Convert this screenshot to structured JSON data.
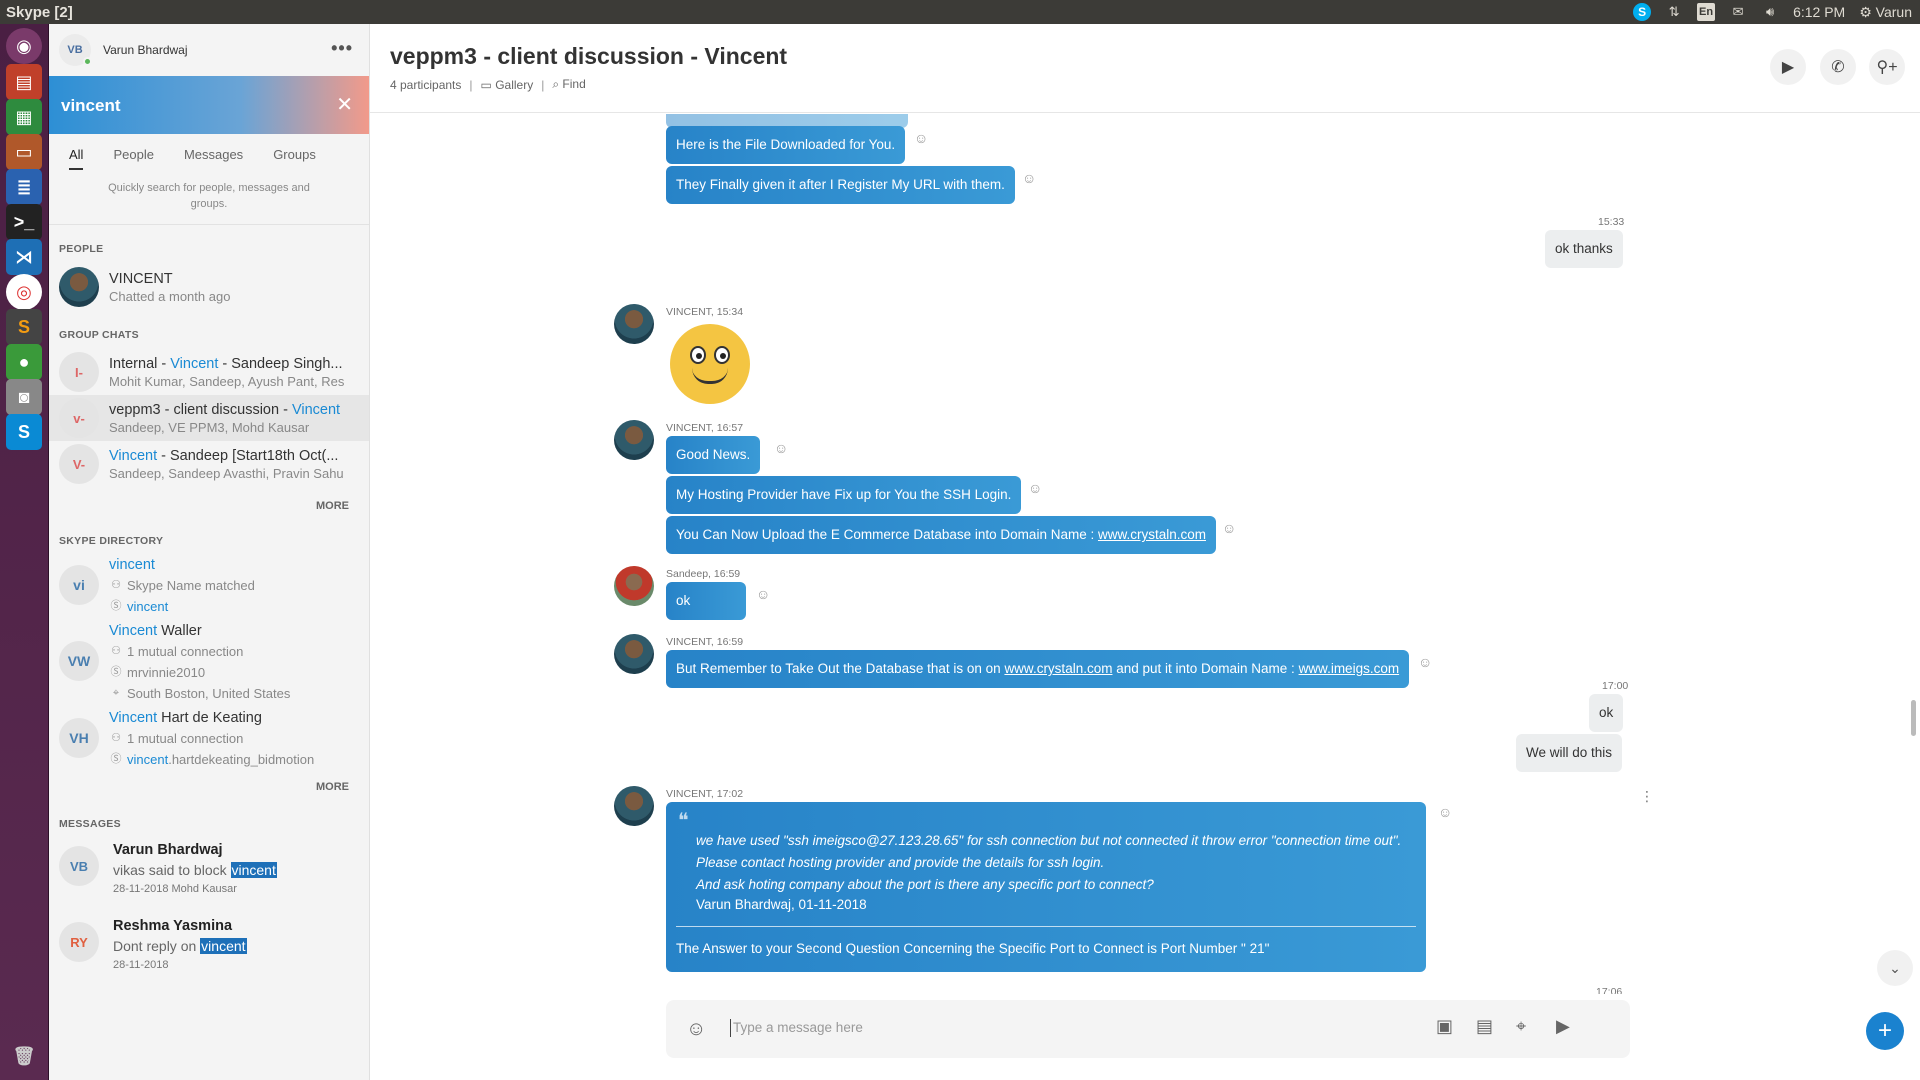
{
  "system": {
    "window_title": "Skype [2]",
    "lang": "En",
    "time": "6:12 PM",
    "user": "Varun"
  },
  "profile": {
    "initials": "VB",
    "name": "Varun Bhardwaj"
  },
  "search": {
    "value": "vincent"
  },
  "filters": [
    "All",
    "People",
    "Messages",
    "Groups"
  ],
  "filter_hint": "Quickly search for people, messages and groups.",
  "sections": {
    "people": "PEOPLE",
    "group_chats": "GROUP CHATS",
    "directory": "SKYPE DIRECTORY",
    "messages": "MESSAGES",
    "more": "MORE"
  },
  "people": [
    {
      "name": "VINCENT",
      "sub": "Chatted a month ago"
    }
  ],
  "group_chats": [
    {
      "initials": "I-",
      "pre": "Internal - ",
      "hl": "Vincent",
      "post": " - Sandeep Singh...",
      "sub": "Mohit Kumar, Sandeep, Ayush Pant, Res"
    },
    {
      "initials": "v-",
      "pre": "veppm3 - client discussion - ",
      "hl": "Vincent",
      "post": "",
      "sub": "Sandeep, VE PPM3, Mohd Kausar"
    },
    {
      "initials": "V-",
      "pre": "",
      "hl": "Vincent",
      "post": " - Sandeep [Start18th Oct(...",
      "sub": "Sandeep, Sandeep Avasthi, Pravin Sahu"
    }
  ],
  "directory": [
    {
      "initials": "vi",
      "hl": "vincent",
      "rest": "",
      "lines": [
        {
          "icon": "people-icon",
          "text": "Skype Name matched",
          "hl": false
        },
        {
          "icon": "skype-icon",
          "text": "vincent",
          "hl": true
        }
      ]
    },
    {
      "initials": "VW",
      "hl": "Vincent",
      "rest": " Waller",
      "lines": [
        {
          "icon": "people-icon",
          "text": "1 mutual connection",
          "hl": false
        },
        {
          "icon": "skype-icon",
          "text": "mrvinnie2010",
          "hl": false
        },
        {
          "icon": "location-icon",
          "text": "South Boston, United States",
          "hl": false
        }
      ]
    },
    {
      "initials": "VH",
      "hl": "Vincent",
      "rest": " Hart de Keating",
      "lines": [
        {
          "icon": "people-icon",
          "text": "1 mutual connection",
          "hl": false
        },
        {
          "icon": "skype-icon",
          "hlpart": "vincent",
          "text": ".hartdekeating_bidmotion",
          "hl": false
        }
      ]
    }
  ],
  "message_results": [
    {
      "initials": "VB",
      "name": "Varun Bhardwaj",
      "pre": "vikas said to block ",
      "hl": "vincent",
      "sub": "28-11-2018 Mohd Kausar"
    },
    {
      "initials": "RY",
      "name": "Reshma Yasmina",
      "pre": "Dont reply on ",
      "hl": "vincent",
      "sub": "28-11-2018"
    }
  ],
  "chat": {
    "title": "veppm3 - client discussion - Vincent",
    "participants": "4 participants",
    "gallery": "Gallery",
    "find": "Find",
    "messages": {
      "m1": "Here is the File Downloaded for You.",
      "m2": "They Finally given it after I Register My URL with them.",
      "t1533": "15:33",
      "out1": "ok thanks",
      "meta1534": "VINCENT, 15:34",
      "meta1657": "VINCENT, 16:57",
      "m3": "Good News.",
      "m4": "My Hosting Provider have Fix up for You the SSH Login.",
      "m5_pre": "You Can Now Upload the E Commerce Database into Domain Name : ",
      "m5_link": "www.crystaln.com",
      "meta_sandeep": "Sandeep, 16:59",
      "m6": "ok",
      "meta1659": "VINCENT, 16:59",
      "m7_a": "But Remember to Take Out the Database that is on on ",
      "m7_l1": "www.crystaln.com",
      "m7_b": " and put it into Domain Name : ",
      "m7_l2": "www.imeigs.com",
      "t1700": "17:00",
      "out2": "ok",
      "out3": "We will do this",
      "meta1702": "VINCENT, 17:02",
      "q1": "we have used \"ssh imeigsco@27.123.28.65\" for ssh connection but not connected it throw error \"connection time out\".",
      "q2": "Please contact hosting provider and provide the details for ssh login.",
      "q3": "And ask hoting company about the port is there any specific port to connect?",
      "qby": "Varun Bhardwaj, 01-11-2018",
      "qans": "The Answer to your Second Question Concerning the Specific Port to Connect is Port Number \" 21\"",
      "t1706": "17:06"
    },
    "composer_placeholder": "Type a message here"
  }
}
